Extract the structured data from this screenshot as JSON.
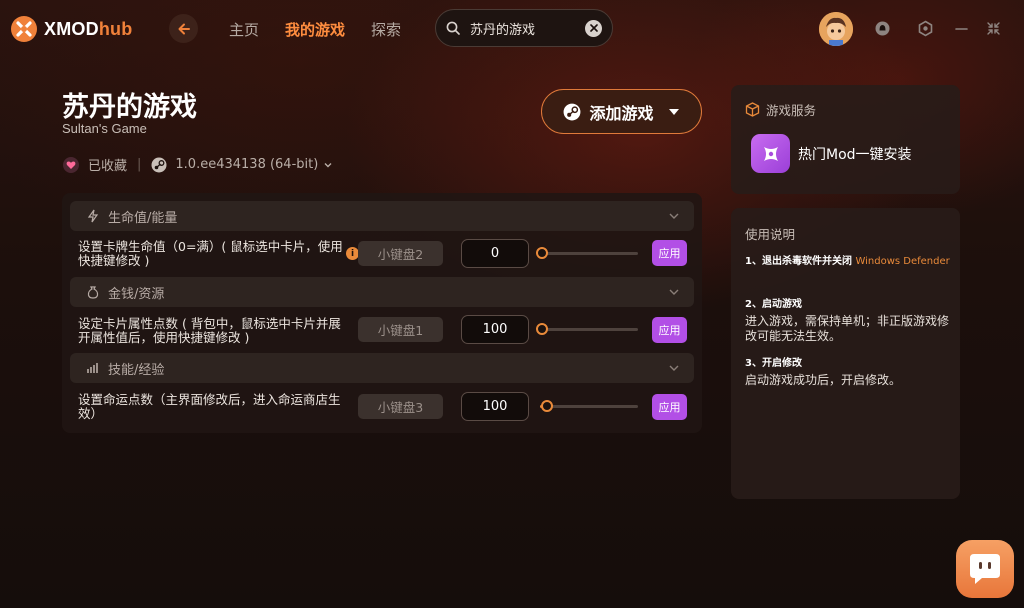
{
  "app": {
    "logo_main": "XMOD",
    "logo_hub": "hub"
  },
  "nav": {
    "home": "主页",
    "my_games": "我的游戏",
    "explore": "探索"
  },
  "search": {
    "value": "苏丹的游戏"
  },
  "header": {
    "title": "苏丹的游戏",
    "subtitle": "Sultan's Game",
    "favorited": "已收藏",
    "version": "1.0.ee434138 (64-bit)",
    "add_game_label": "添加游戏"
  },
  "sections": [
    {
      "title": "生命值/能量",
      "row": {
        "label": "设置卡牌生命值（0=满）( 鼠标选中卡片，使用快捷键修改 )",
        "hotkey": "小键盘2",
        "value": "0",
        "slider": 0.0,
        "apply": "应用"
      }
    },
    {
      "title": "金钱/资源",
      "row": {
        "label": "设定卡片属性点数 ( 背包中，鼠标选中卡片并展开属性值后，使用快捷键修改 )",
        "hotkey": "小键盘1",
        "value": "100",
        "slider": 0.0,
        "apply": "应用"
      }
    },
    {
      "title": "技能/经验",
      "row": {
        "label": "设置命运点数（主界面修改后，进入命运商店生效）",
        "hotkey": "小键盘3",
        "value": "100",
        "slider": 0.05,
        "apply": "应用"
      }
    }
  ],
  "service": {
    "title": "游戏服务",
    "item": "热门Mod一键安装"
  },
  "help": {
    "title": "使用说明",
    "step1_head": "1、退出杀毒软件并关闭",
    "step1_accent": "Windows Defender",
    "step2_head": "2、启动游戏",
    "step2_body": "进入游戏，需保持单机；非正版游戏修改可能无法生效。",
    "step3_head": "3、开启修改",
    "step3_body": "启动游戏成功后，开启修改。"
  },
  "colors": {
    "accent": "#e98a3a",
    "apply": "#b24fe6",
    "nav_active": "#ff8d3f"
  }
}
